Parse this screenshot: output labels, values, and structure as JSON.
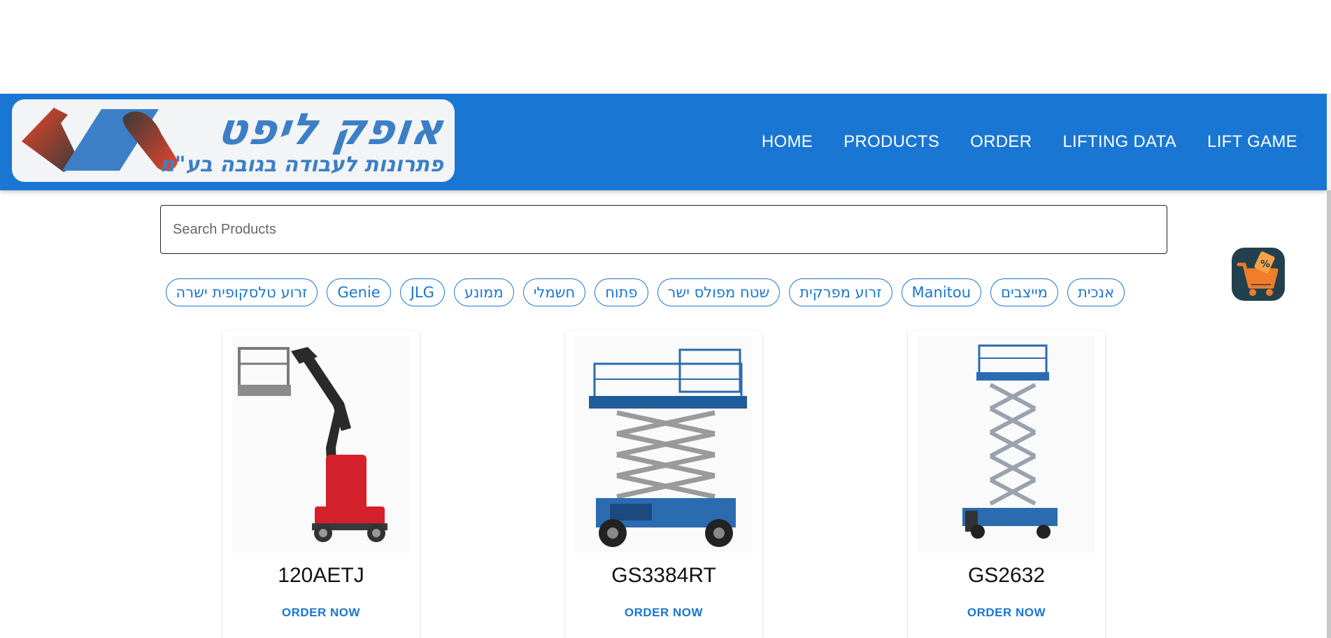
{
  "logo": {
    "title": "אופק ליפט",
    "subtitle": "פתרונות לעבודה בגובה בע\"מ"
  },
  "nav": {
    "items": [
      "HOME",
      "PRODUCTS",
      "ORDER",
      "LIFTING DATA",
      "LIFT GAME"
    ]
  },
  "search": {
    "placeholder": "Search Products",
    "value": ""
  },
  "filters": {
    "chips": [
      "אנכית",
      "מייצבים",
      "Manitou",
      "זרוע מפרקית",
      "שטח מפולס ישר",
      "פתוח",
      "חשמלי",
      "ממונע",
      "JLG",
      "Genie",
      "זרוע טלסקופית ישרה"
    ]
  },
  "products": [
    {
      "name": "120AETJ",
      "button": "ORDER NOW",
      "image_icon": "articulated-boom-lift-icon"
    },
    {
      "name": "GS3384RT",
      "button": "ORDER NOW",
      "image_icon": "rough-terrain-scissor-lift-icon"
    },
    {
      "name": "GS2632",
      "button": "ORDER NOW",
      "image_icon": "slab-scissor-lift-icon"
    }
  ],
  "colors": {
    "primary": "#1976d2",
    "fab": "#23404e",
    "cart": "#f07d2a"
  }
}
